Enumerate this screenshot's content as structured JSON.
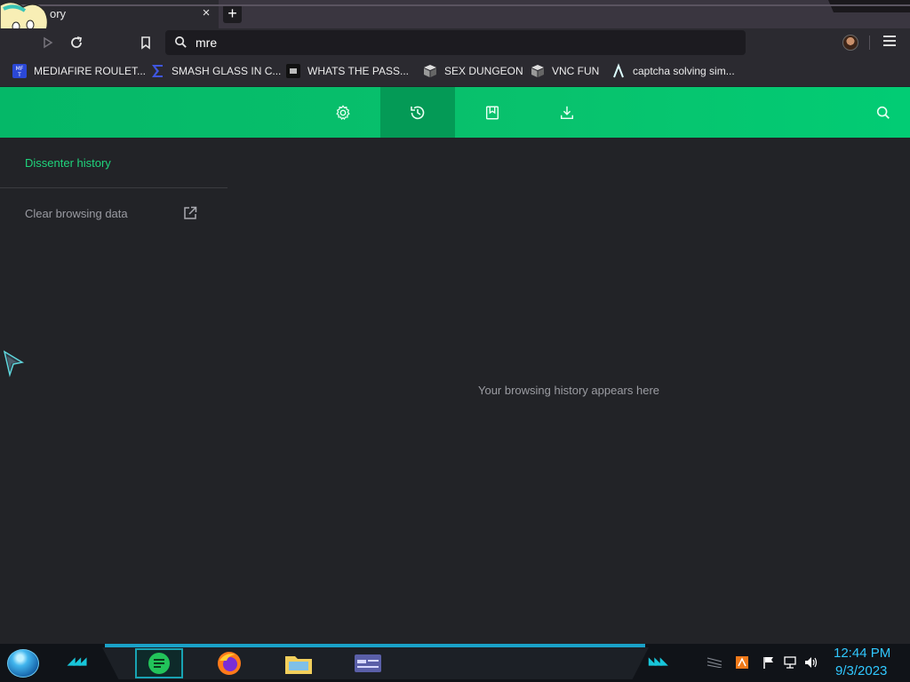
{
  "browser": {
    "tab": {
      "title": "ory",
      "close": "×"
    },
    "new_tab": "+",
    "address": {
      "value": "mre"
    },
    "bookmarks": [
      {
        "label": "MEDIAFIRE ROULET...",
        "icon": "mediafire-icon"
      },
      {
        "label": "SMASH GLASS IN C...",
        "icon": "sigma-icon"
      },
      {
        "label": "WHATS THE PASS...",
        "icon": "app-icon"
      },
      {
        "label": "SEX DUNGEON",
        "icon": "cube-icon"
      },
      {
        "label": "VNC FUN",
        "icon": "cube-icon"
      },
      {
        "label": "captcha solving sim...",
        "icon": "lambda-icon"
      }
    ]
  },
  "page": {
    "header_tabs": [
      {
        "name": "settings",
        "icon": "gear-icon"
      },
      {
        "name": "history",
        "icon": "history-icon",
        "active": true
      },
      {
        "name": "bookmarks",
        "icon": "bookmark-icon"
      },
      {
        "name": "downloads",
        "icon": "download-icon"
      }
    ],
    "sidebar": {
      "title": "Dissenter history",
      "clear_label": "Clear browsing data"
    },
    "empty_message": "Your browsing history appears here",
    "accent_color": "#0ec46b"
  },
  "taskbar": {
    "time": "12:44 PM",
    "date": "9/3/2023",
    "apps": [
      "notes-icon",
      "firefox-icon",
      "file-manager-icon",
      "window-icon"
    ]
  }
}
